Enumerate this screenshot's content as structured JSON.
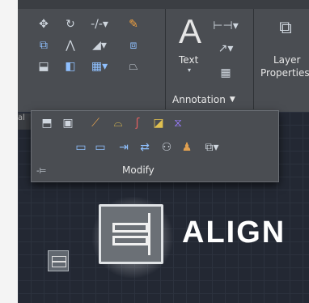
{
  "ribbon": {
    "annotation": {
      "text_tool_glyph": "A",
      "text_label": "Text",
      "panel_title": "Annotation",
      "panel_arrow": "▼"
    },
    "layers": {
      "label_line1": "Layer",
      "label_line2": "Properties"
    }
  },
  "modify_panel": {
    "title": "Modify",
    "pin_glyph": "-⊨"
  },
  "overlay": {
    "tool_name": "ALIGN"
  },
  "colors": {
    "ribbon_bg": "#4a4d52",
    "canvas_bg": "#232833",
    "highlight": "#ffffff"
  }
}
